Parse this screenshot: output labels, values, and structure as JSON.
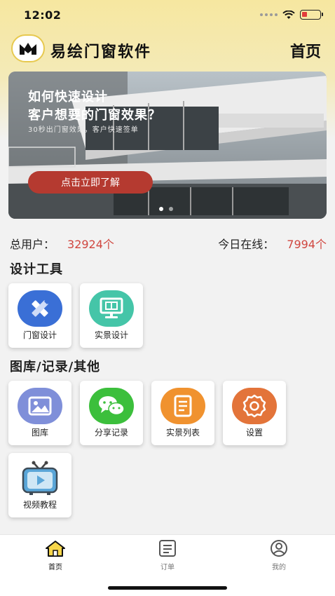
{
  "status": {
    "time": "12:02"
  },
  "nav": {
    "app_title": "易绘门窗软件",
    "home_label": "首页"
  },
  "banner": {
    "title_line1": "如何快速设计",
    "title_line2": "客户想要的门窗效果？",
    "subtitle": "30秒出门窗效果，客户快速签单",
    "cta_label": "点击立即了解"
  },
  "stats": {
    "total_users_label": "总用户：",
    "total_users_value": "32924个",
    "online_today_label": "今日在线：",
    "online_today_value": "7994个"
  },
  "sections": {
    "design_tools_title": "设计工具",
    "library_title": "图库/记录/其他"
  },
  "design_tools": [
    {
      "label": "门窗设计",
      "icon": "pencil-ruler-icon",
      "color": "#3a6fd6"
    },
    {
      "label": "实景设计",
      "icon": "monitor-icon",
      "color": "#45c5a8"
    }
  ],
  "library_tools": [
    {
      "label": "图库",
      "icon": "picture-icon",
      "color": "#7f8fd9"
    },
    {
      "label": "分享记录",
      "icon": "wechat-icon",
      "color": "#3cbf3c"
    },
    {
      "label": "实景列表",
      "icon": "list-doc-icon",
      "color": "#f0922f"
    },
    {
      "label": "设置",
      "icon": "gear-icon",
      "color": "#e3743a"
    },
    {
      "label": "视频教程",
      "icon": "tv-icon",
      "color": "#5aa6d8"
    }
  ],
  "tabbar": [
    {
      "label": "首页",
      "icon": "house-icon"
    },
    {
      "label": "订单",
      "icon": "order-list-icon"
    },
    {
      "label": "我的",
      "icon": "user-icon"
    }
  ],
  "colors": {
    "accent_red": "#d0463f",
    "header_yellow": "#f6e7a0",
    "cta_red": "#b53a30"
  }
}
